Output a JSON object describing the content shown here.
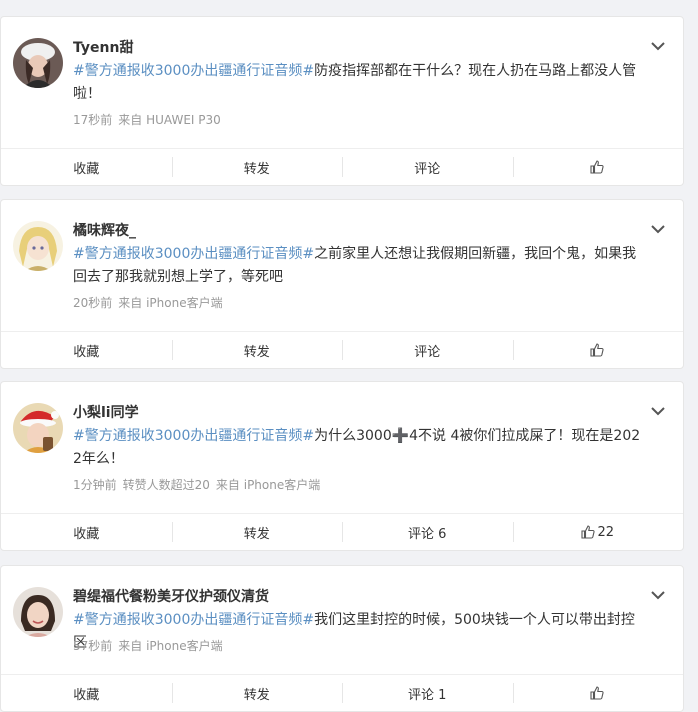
{
  "posts": [
    {
      "username": "Tyenn甜",
      "hashtag": "#警方通报收3000办出疆通行证音频#",
      "text": "防疫指挥部都在干什么？现在人扔在马路上都没人管啦！",
      "time": "17秒前",
      "source": "来自 HUAWEI P30",
      "extra": "",
      "actions": {
        "favorite": "收藏",
        "forward": "转发",
        "comment": "评论",
        "like": ""
      },
      "avatar_icon": "avatar-girl-white-hat"
    },
    {
      "username": "橘味辉夜_",
      "hashtag": "#警方通报收3000办出疆通行证音频#",
      "text": "之前家里人还想让我假期回新疆，我回个鬼，如果我回去了那我就别想上学了，等死吧",
      "time": "20秒前",
      "source": "来自 iPhone客户端",
      "extra": "",
      "actions": {
        "favorite": "收藏",
        "forward": "转发",
        "comment": "评论",
        "like": ""
      },
      "avatar_icon": "avatar-anime-blonde"
    },
    {
      "username": "小梨li同学",
      "hashtag": "#警方通报收3000办出疆通行证音频#",
      "text": "为什么3000➕4不说 4被你们拉成屎了！现在是2022年么！",
      "time": "1分钟前",
      "source": "来自 iPhone客户端",
      "extra": "转赞人数超过20",
      "actions": {
        "favorite": "收藏",
        "forward": "转发",
        "comment": "评论 6",
        "like": "22"
      },
      "avatar_icon": "avatar-girl-santa-hat"
    },
    {
      "username": "碧缇福代餐粉美牙仪护颈仪清货",
      "hashtag": "#警方通报收3000办出疆通行证音频#",
      "text": "我们这里封控的时候，500块钱一个人可以带出封控区",
      "time": "57秒前",
      "source": "来自 iPhone客户端",
      "extra": "",
      "actions": {
        "favorite": "收藏",
        "forward": "转发",
        "comment": "评论 1",
        "like": ""
      },
      "avatar_icon": "avatar-girl-smiling"
    }
  ],
  "colors": {
    "hashtag": "#5b8fc2",
    "background": "#f1f2f5"
  }
}
